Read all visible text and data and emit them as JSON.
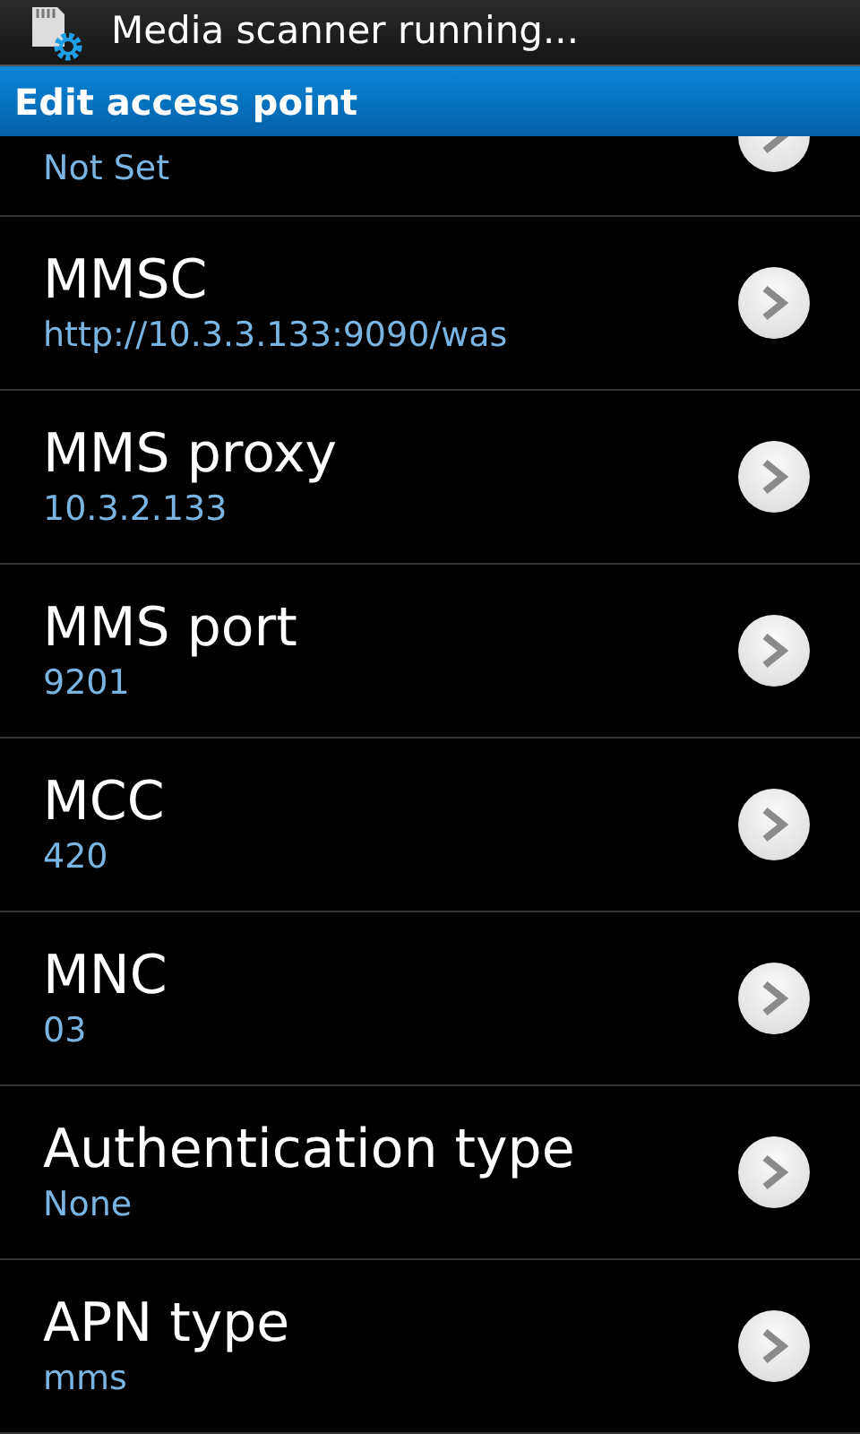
{
  "status_bar": {
    "notification": "Media scanner running..."
  },
  "title_bar": {
    "title": "Edit access point"
  },
  "settings": [
    {
      "value": "Not Set",
      "partial": true
    },
    {
      "title": "MMSC",
      "value": "http://10.3.3.133:9090/was"
    },
    {
      "title": "MMS proxy",
      "value": "10.3.2.133"
    },
    {
      "title": "MMS port",
      "value": "9201"
    },
    {
      "title": "MCC",
      "value": "420"
    },
    {
      "title": "MNC",
      "value": "03"
    },
    {
      "title": "Authentication type",
      "value": "None"
    },
    {
      "title": "APN type",
      "value": "mms"
    }
  ]
}
